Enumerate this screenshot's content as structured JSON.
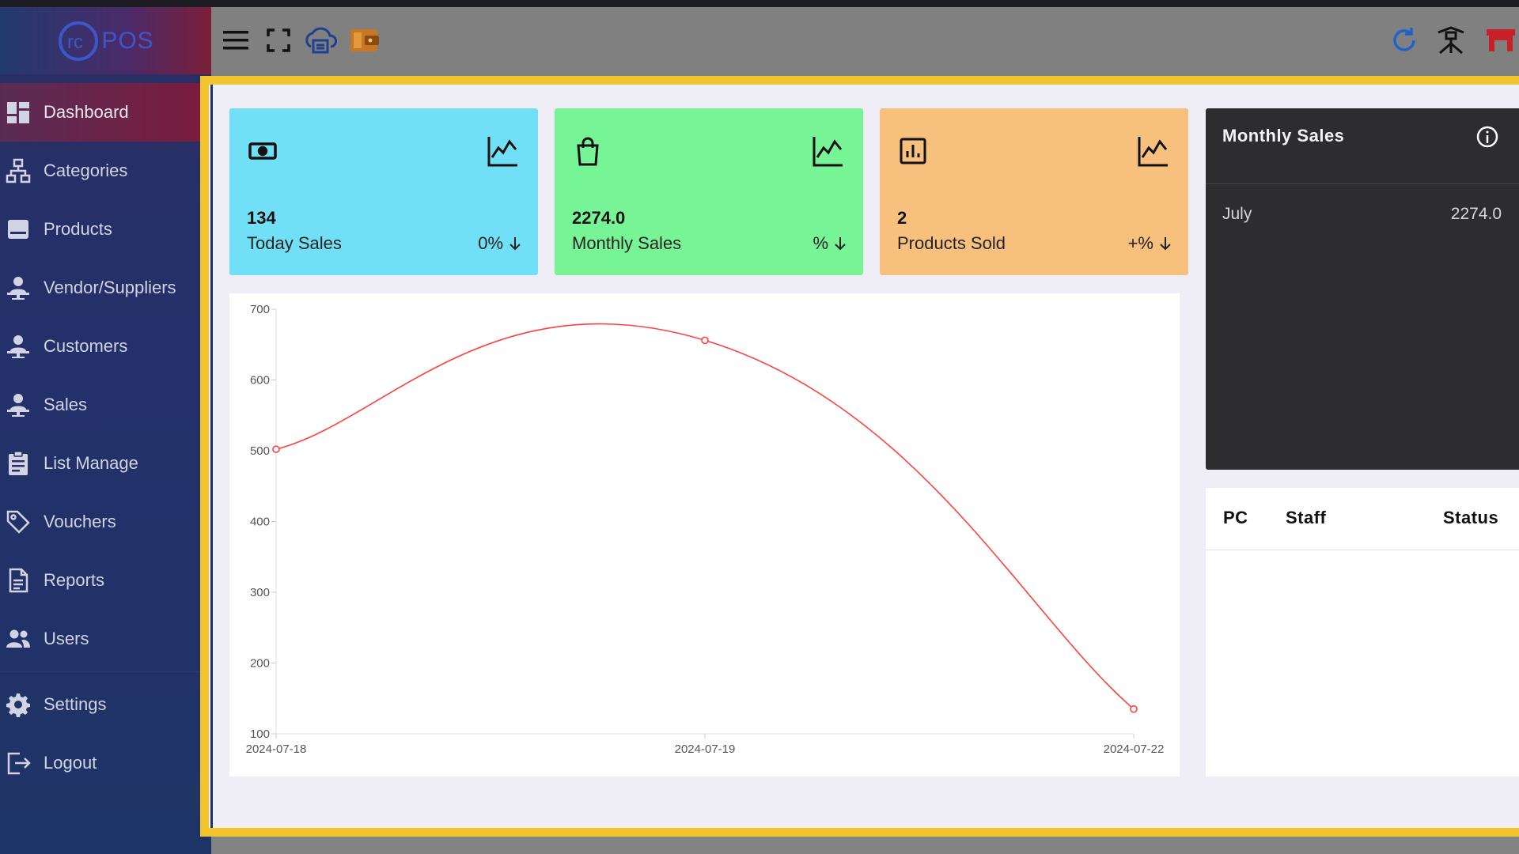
{
  "app": {
    "logo_text": "POS"
  },
  "sidebar": {
    "items": [
      {
        "label": "Dashboard",
        "icon": "dashboard-icon",
        "active": true
      },
      {
        "label": "Categories",
        "icon": "sitemap-icon",
        "active": false
      },
      {
        "label": "Products",
        "icon": "box-icon",
        "active": false
      },
      {
        "label": "Vendor/Suppliers",
        "icon": "person-desk-icon",
        "active": false
      },
      {
        "label": "Customers",
        "icon": "person-desk-icon",
        "active": false
      },
      {
        "label": "Sales",
        "icon": "person-desk-icon",
        "active": false
      },
      {
        "label": "List Manage",
        "icon": "clipboard-icon",
        "active": false
      },
      {
        "label": "Vouchers",
        "icon": "tag-icon",
        "active": false
      },
      {
        "label": "Reports",
        "icon": "document-icon",
        "active": false
      },
      {
        "label": "Users",
        "icon": "users-icon",
        "active": false
      },
      {
        "label": "Settings",
        "icon": "gear-icon",
        "active": false
      },
      {
        "label": "Logout",
        "icon": "logout-icon",
        "active": false
      }
    ]
  },
  "topbar": {
    "icons": [
      "menu-icon",
      "fullscreen-icon",
      "cloud-print-icon",
      "wallet-icon",
      "refresh-icon",
      "network-icon",
      "store-icon"
    ]
  },
  "cards": [
    {
      "value": "134",
      "label": "Today Sales",
      "change": "0%",
      "icon": "cash-icon",
      "color": "#71dff5"
    },
    {
      "value": "2274.0",
      "label": "Monthly Sales",
      "change": "%",
      "icon": "shopping-bag-icon",
      "color": "#77f495"
    },
    {
      "value": "2",
      "label": "Products Sold",
      "change": "+%",
      "icon": "bar-chart-icon",
      "color": "#f7c17d"
    }
  ],
  "monthly_sales": {
    "title": "Monthly Sales",
    "rows": [
      {
        "month": "July",
        "amount": "2274.0"
      }
    ]
  },
  "staff_table": {
    "headers": [
      "PC",
      "Staff",
      "Status"
    ]
  },
  "chart_data": {
    "type": "line",
    "x": [
      "2024-07-18",
      "2024-07-19",
      "2024-07-22"
    ],
    "series": [
      {
        "values": [
          502,
          656,
          135
        ],
        "color": "#ff4040"
      }
    ],
    "y_ticks": [
      "700",
      "600",
      "500",
      "400",
      "300",
      "200",
      "100"
    ],
    "ylim": [
      100,
      700
    ],
    "title": "",
    "xlabel": "",
    "ylabel": ""
  }
}
